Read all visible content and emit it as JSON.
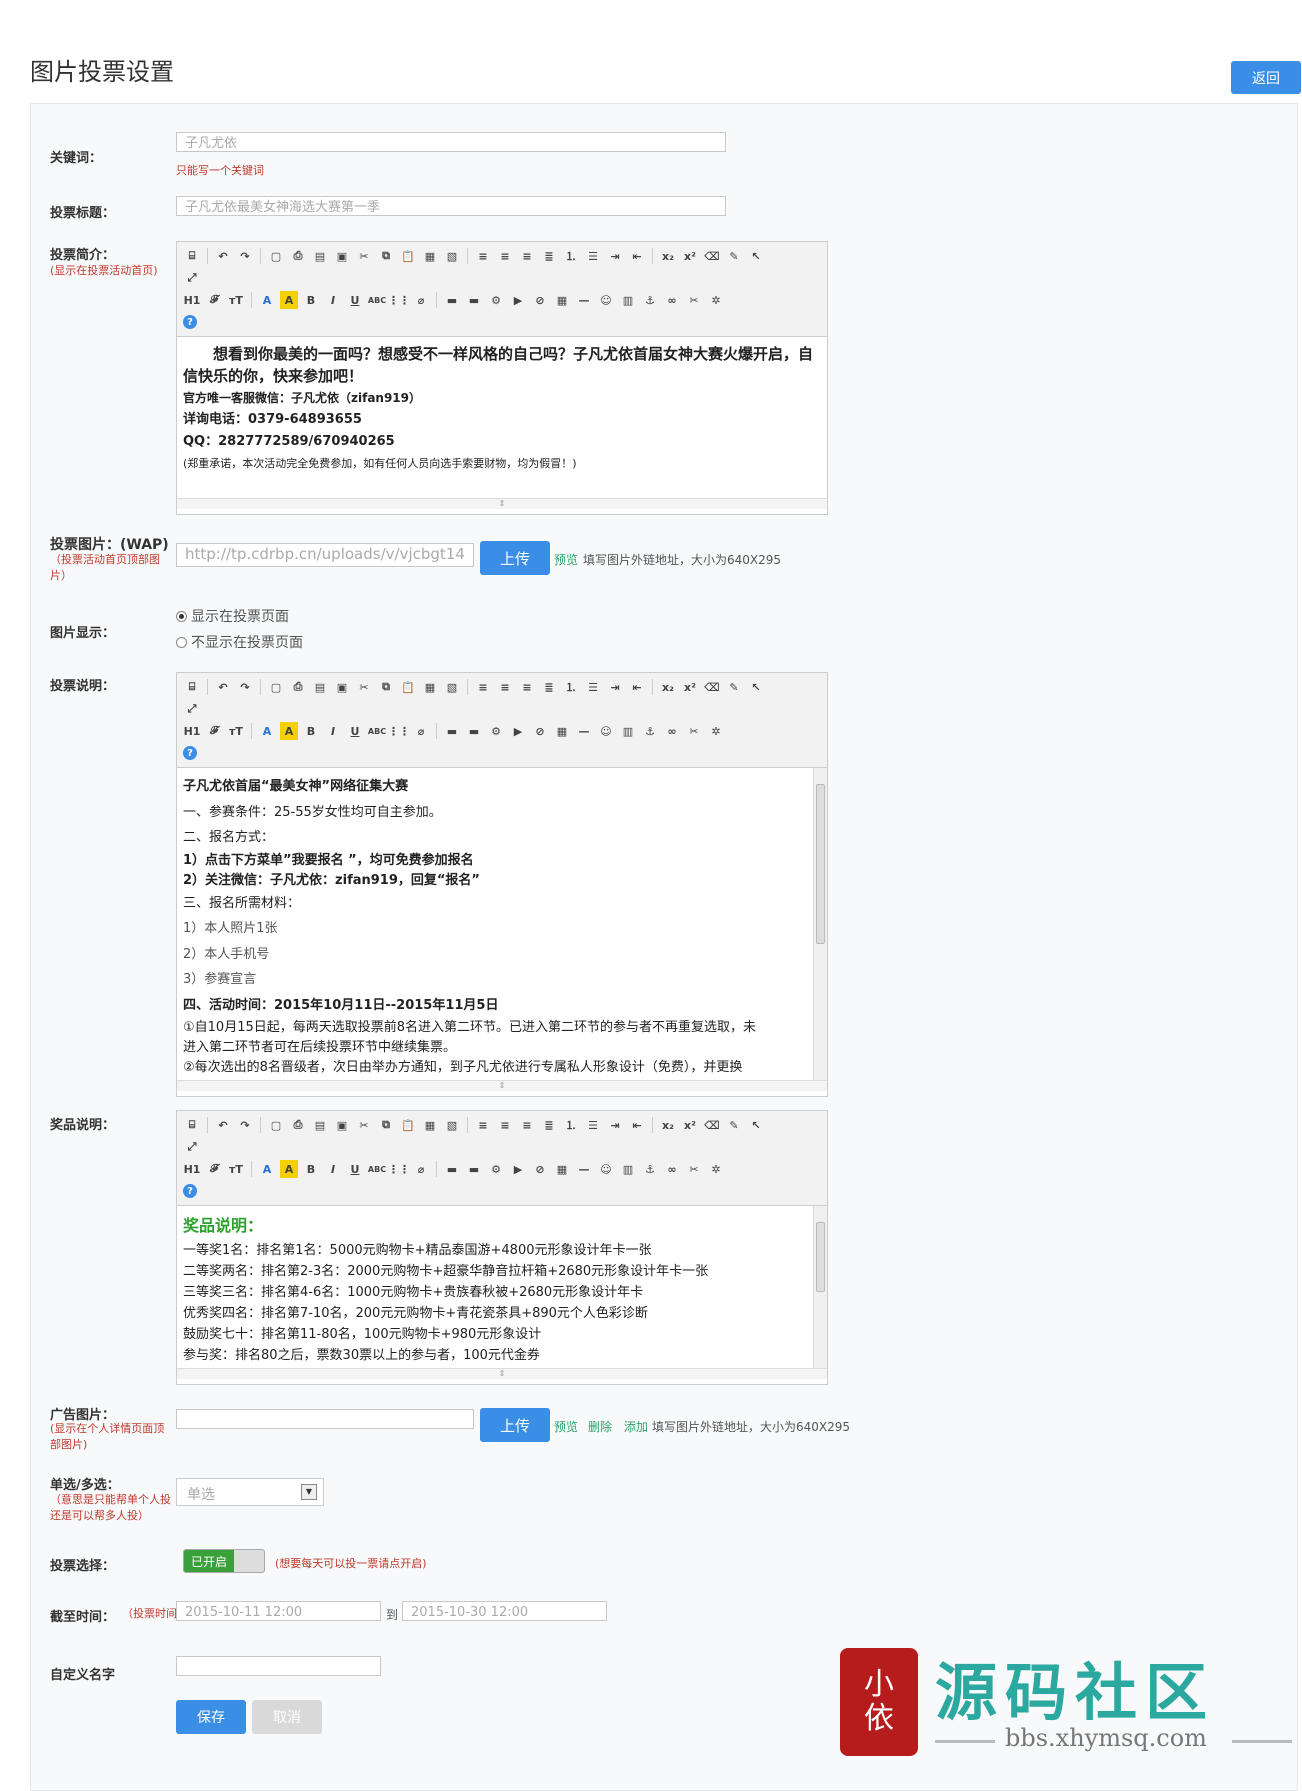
{
  "page": {
    "title": "图片投票设置",
    "back": "返回"
  },
  "keyword": {
    "label": "关键词：",
    "value": "子凡尤依",
    "hint": "只能写一个关键词"
  },
  "vote_title": {
    "label": "投票标题：",
    "value": "子凡尤依最美女神海选大赛第一季"
  },
  "intro": {
    "label": "投票简介：",
    "note": "(显示在投票活动首页)",
    "lines": [
      "想看到你最美的一面吗？想感受不一样风格的自己吗？子凡尤依首届女神大赛火爆开启，自",
      "信快乐的你，快来参加吧！",
      "官方唯一客服微信：子凡尤依（zifan919）",
      "详询电话：0379-64893655",
      "QQ：2827772589/670940265",
      "(郑重承诺，本次活动完全免费参加，如有任何人员向选手索要财物，均为假冒！)"
    ]
  },
  "vote_image": {
    "label": "投票图片：(WAP)",
    "note": "（投票活动首页顶部图片）",
    "value": "http://tp.cdrbp.cn/uploads/v/vjcbgt14",
    "upload": "上传",
    "preview": "预览",
    "hint": "填写图片外链地址，大小为640X295"
  },
  "image_display": {
    "label": "图片显示：",
    "options": [
      "显示在投票页面",
      "不显示在投票页面"
    ]
  },
  "vote_desc": {
    "label": "投票说明：",
    "lines": [
      "子凡尤依首届“最美女神”网络征集大赛",
      "一、参赛条件：25-55岁女性均可自主参加。",
      "二、报名方式：",
      "1）点击下方菜单”我要报名 ”，均可免费参加报名",
      "2）关注微信：子凡尤依：zifan919，回复“报名”",
      "三、报名所需材料：",
      "1）本人照片1张",
      "2）本人手机号",
      "3）参赛宣言",
      "四、活动时间：2015年10月11日--2015年11月5日",
      "①自10月15日起，每两天选取投票前8名进入第二环节。已进入第二环节的参与者不再重复选取，未",
      "进入第二环节者可在后续投票环节中继续集票。",
      "②每次选出的8名晋级者，次日由举办方通知，到子凡尤依进行专属私人形象设计（免费），并更换"
    ]
  },
  "prize_desc": {
    "label": "奖品说明：",
    "heading": "奖品说明：",
    "lines": [
      "一等奖1名：排名第1名：5000元购物卡+精品泰国游+4800元形象设计年卡一张",
      "二等奖两名：排名第2-3名：2000元购物卡+超豪华静音拉杆箱+2680元形象设计年卡一张",
      "三等奖三名：排名第4-6名：1000元购物卡+贵族春秋被+2680元形象设计年卡",
      "优秀奖四名：排名第7-10名，200元元购物卡+青花瓷茶具+890元个人色彩诊断",
      "鼓励奖七十：排名第11-80名，100元购物卡+980元形象设计",
      "参与奖：排名80之后，票数30票以上的参与者，100元代金券"
    ]
  },
  "ad_image": {
    "label": "广告图片：",
    "note": "(显示在个人详情页面顶部图片)",
    "upload": "上传",
    "preview": "预览",
    "delete": "删除",
    "add": "添加",
    "hint": "填写图片外链地址，大小为640X295"
  },
  "choice": {
    "label": "单选/多选：",
    "note": "（意思是只能帮单个人投 还是可以帮多人投）",
    "value": "单选"
  },
  "vote_choice": {
    "label": "投票选择：",
    "toggle": "已开启",
    "hint": "(想要每天可以投一票请点开启)"
  },
  "deadline": {
    "label": "截至时间：",
    "note": "（投票时间）",
    "start": "2015-10-11 12:00",
    "to": "到",
    "end": "2015-10-30 12:00"
  },
  "custom_name": {
    "label": "自定义名字"
  },
  "actions": {
    "save": "保存",
    "cancel": "取消"
  },
  "toolbar": {
    "row1": [
      "source-icon",
      "undo-icon",
      "redo-icon",
      "preview-icon",
      "print-icon",
      "template-icon",
      "select-all-icon",
      "cut-icon",
      "copy-icon",
      "paste-icon",
      "paste-text-icon",
      "paste-word-icon",
      "align-left-icon",
      "align-center-icon",
      "align-right-icon",
      "justify-icon",
      "ordered-list-icon",
      "unordered-list-icon",
      "indent-icon",
      "outdent-icon",
      "subscript-icon",
      "superscript-icon",
      "clear-format-icon",
      "quick-format-icon",
      "select-icon",
      "fullscreen-icon"
    ],
    "row2_text": {
      "h1": "H1",
      "font": "F",
      "size": "T",
      "color": "A",
      "bg": "A",
      "bold": "B",
      "italic": "I",
      "underline": "U",
      "strike": "ABC"
    }
  },
  "watermark": {
    "brand": "源码社区",
    "url": "bbs.xhymsq.com",
    "seal": "小依",
    "accent": "#2ba8a0",
    "seal_color": "#b71c1c"
  }
}
